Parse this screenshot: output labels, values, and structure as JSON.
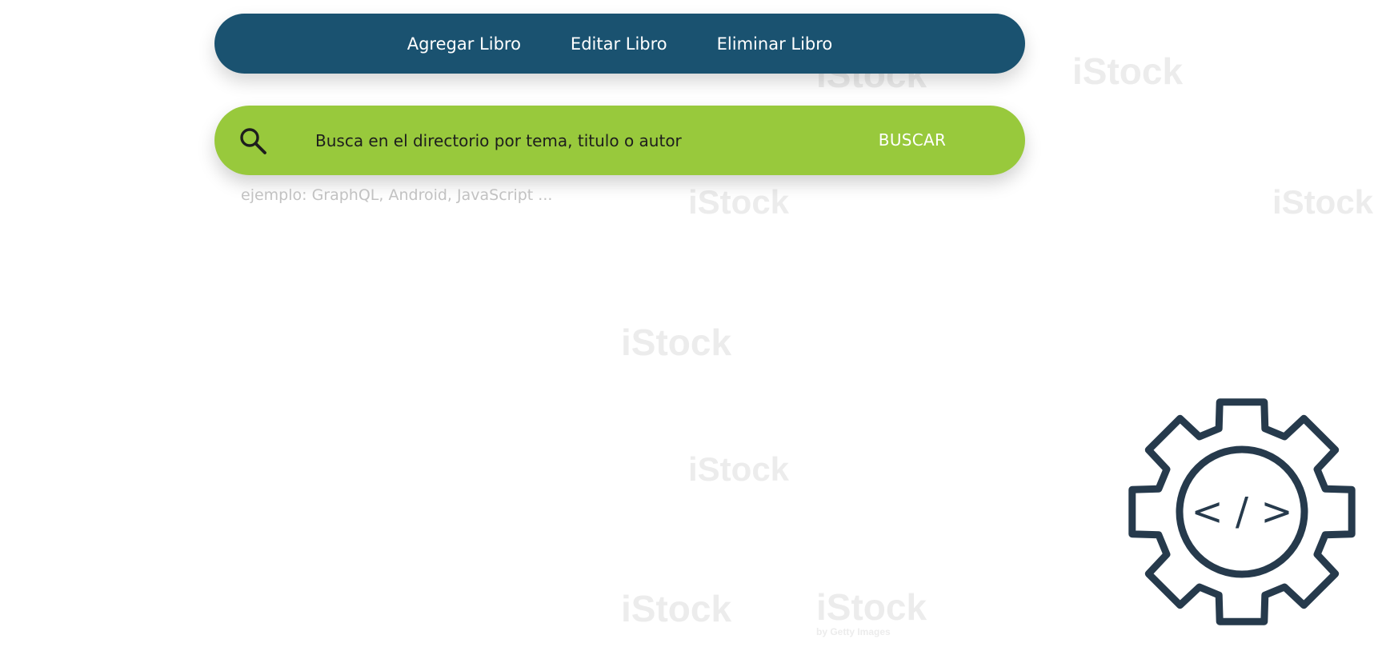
{
  "nav": {
    "items": [
      {
        "label": "Agregar Libro"
      },
      {
        "label": "Editar Libro"
      },
      {
        "label": "Eliminar Libro"
      }
    ]
  },
  "search": {
    "placeholder": "Busca en el directorio por tema, titulo o autor",
    "value": "",
    "button_label": "BUSCAR",
    "icon": "search-icon"
  },
  "hint": {
    "text": "ejemplo: GraphQL, Android, JavaScript ..."
  },
  "graphic": {
    "icon": "gear-code-icon",
    "code_glyph": "< / >"
  },
  "watermark": {
    "brand": "iStock",
    "tagline": "by Getty Images"
  },
  "colors": {
    "nav_background": "#1a5270",
    "search_background": "#98c93c",
    "hint_text": "#c2c2c2",
    "icon_stroke": "#263a4c"
  }
}
